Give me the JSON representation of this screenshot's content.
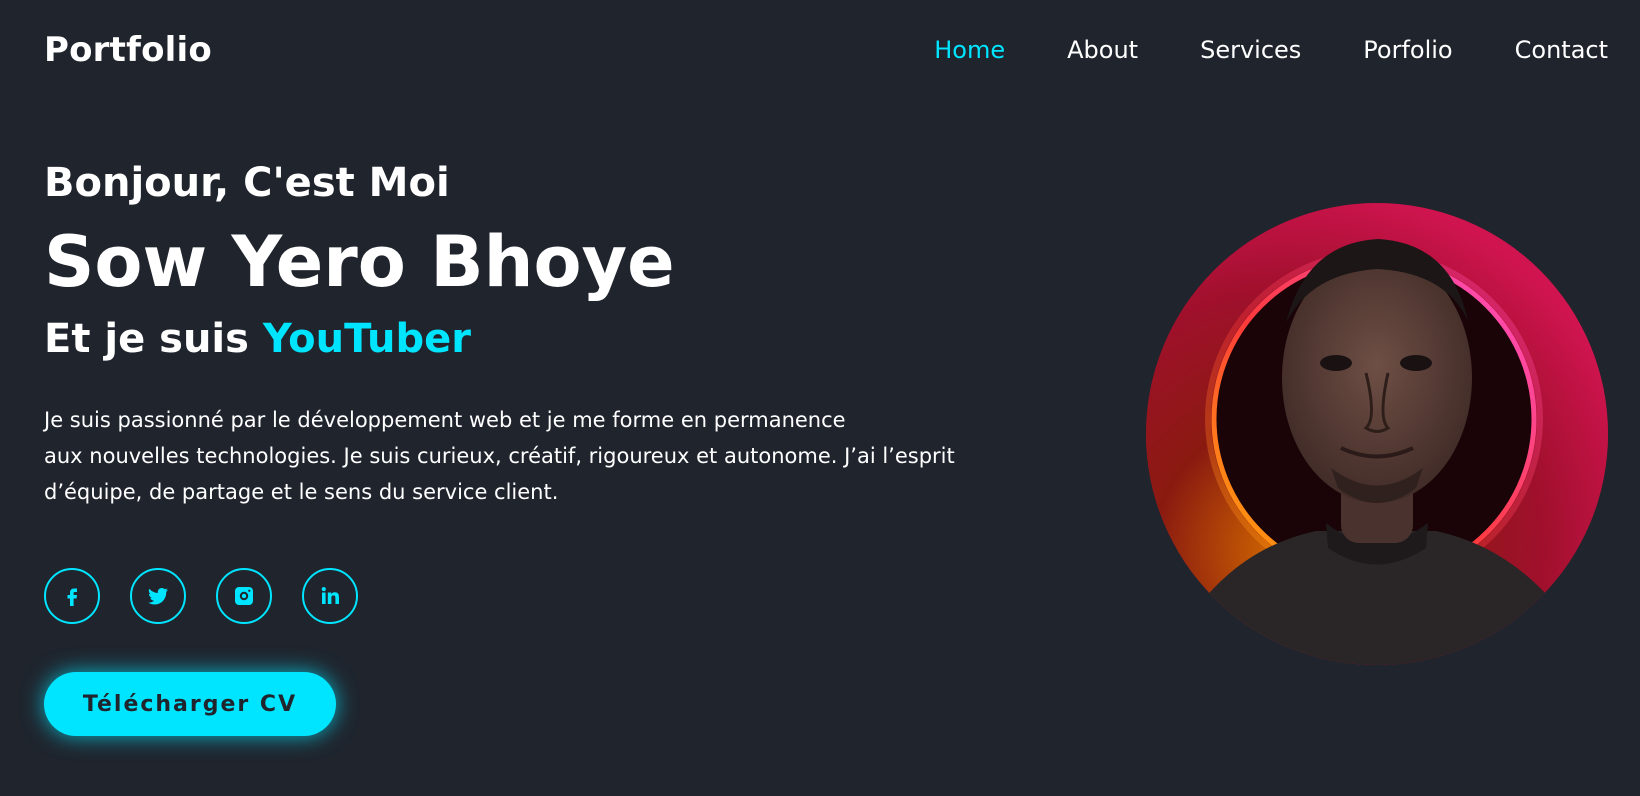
{
  "header": {
    "logo": "Portfolio",
    "nav": [
      {
        "label": "Home",
        "active": true
      },
      {
        "label": "About",
        "active": false
      },
      {
        "label": "Services",
        "active": false
      },
      {
        "label": "Porfolio",
        "active": false
      },
      {
        "label": "Contact",
        "active": false
      }
    ]
  },
  "hero": {
    "greeting": "Bonjour, C'est Moi",
    "name": "Sow Yero Bhoye",
    "role_prefix": "Et je suis ",
    "role_highlight": "YouTuber",
    "bio_line1": "Je suis passionné par le développement web et je me forme en permanence",
    "bio_line2": "aux nouvelles technologies. Je suis curieux, créatif, rigoureux et autonome. J’ai l’esprit",
    "bio_line3": "d’équipe, de partage et le sens du service client.",
    "cv_button": "Télécharger CV"
  },
  "socials": [
    {
      "icon": "facebook-icon"
    },
    {
      "icon": "twitter-icon"
    },
    {
      "icon": "instagram-icon"
    },
    {
      "icon": "linkedin-icon"
    }
  ],
  "colors": {
    "background": "#1f242d",
    "accent": "#00e5ff",
    "text": "#ffffff"
  }
}
